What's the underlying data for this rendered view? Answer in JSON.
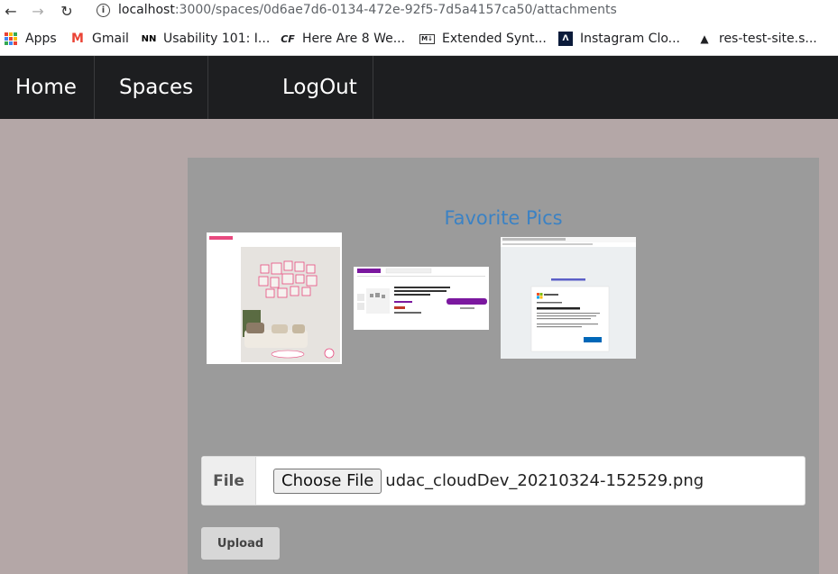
{
  "browser": {
    "url_host": "localhost",
    "url_path": ":3000/spaces/0d6ae7d6-0134-472e-92f5-7d5a4157ca50/attachments",
    "icons": {
      "back": "arrow-left-icon",
      "forward": "arrow-right-icon",
      "reload": "reload-icon",
      "info": "info-icon"
    }
  },
  "bookmarks": [
    {
      "label": "Apps",
      "icon": "apps-grid-icon"
    },
    {
      "label": "Gmail",
      "icon": "gmail-icon"
    },
    {
      "label": "Usability 101: I...",
      "icon": "nn-icon"
    },
    {
      "label": "Here Are 8 We...",
      "icon": "cf-icon"
    },
    {
      "label": "Extended Synt...",
      "icon": "markdown-icon"
    },
    {
      "label": "Instagram Clo...",
      "icon": "instagram-clone-icon"
    },
    {
      "label": "res-test-site.s...",
      "icon": "triangle-icon"
    }
  ],
  "navbar": {
    "home": "Home",
    "spaces": "Spaces",
    "logout": "LogOut"
  },
  "space": {
    "title": "Favorite Pics",
    "attachments": [
      {
        "name": "wall-gallery-thumbnail"
      },
      {
        "name": "wayfair-product-thumbnail"
      },
      {
        "name": "microsoft-teams-thumbnail"
      }
    ]
  },
  "upload_form": {
    "file_label": "File",
    "choose_button": "Choose File",
    "selected_file": "udac_cloudDev_20210324-152529.png",
    "upload_button": "Upload"
  },
  "colors": {
    "page_bg": "#b4a7a7",
    "navbar_bg": "#1d1e20",
    "card_bg": "#9b9b9b",
    "title": "#3b82c4"
  }
}
